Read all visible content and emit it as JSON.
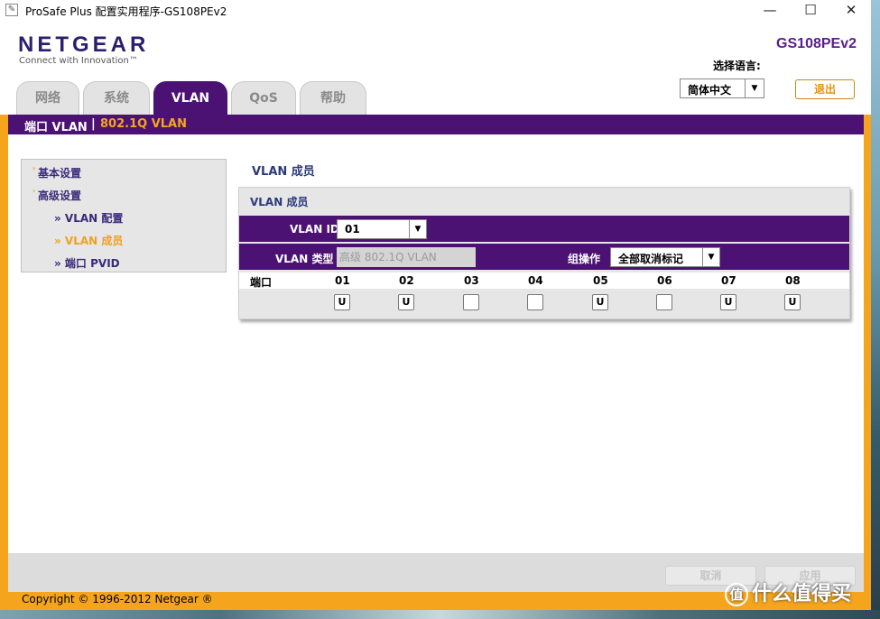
{
  "window": {
    "title": "ProSafe Plus 配置实用程序-GS108PEv2",
    "minimize": "—",
    "maximize": "☐",
    "close": "✕"
  },
  "header": {
    "logo": "NETGEAR",
    "logo_sub": "Connect with Innovation™",
    "model": "GS108PEv2",
    "lang_label": "选择语言:",
    "lang_value": "简体中文",
    "logout": "退出"
  },
  "tabs": [
    {
      "label": "网络"
    },
    {
      "label": "系统"
    },
    {
      "label": "VLAN"
    },
    {
      "label": "QoS"
    },
    {
      "label": "帮助"
    }
  ],
  "subnav": {
    "item1": "端口 VLAN",
    "separator": "|",
    "item2": "802.1Q VLAN"
  },
  "sidebar": {
    "basic": "基本设置",
    "advanced": "高级设置",
    "vlan_config": "» VLAN 配置",
    "vlan_members": "» VLAN 成员",
    "port_pvid": "» 端口 PVID"
  },
  "main": {
    "page_title": "VLAN 成员",
    "panel_title": "VLAN 成员",
    "vlan_id_label": "VLAN ID",
    "vlan_id_value": "01",
    "vlan_type_label": "VLAN 类型",
    "vlan_type_value": "高级 802.1Q VLAN",
    "group_op_label": "组操作",
    "group_op_value": "全部取消标记",
    "ports_label": "端口",
    "ports": [
      {
        "id": "01",
        "state": "U"
      },
      {
        "id": "02",
        "state": "U"
      },
      {
        "id": "03",
        "state": ""
      },
      {
        "id": "04",
        "state": ""
      },
      {
        "id": "05",
        "state": "U"
      },
      {
        "id": "06",
        "state": ""
      },
      {
        "id": "07",
        "state": "U"
      },
      {
        "id": "08",
        "state": "U"
      }
    ]
  },
  "footer": {
    "cancel": "取消",
    "apply": "应用",
    "copyright": "Copyright © 1996-2012 Netgear ®"
  },
  "watermark": {
    "glyph": "值",
    "text": "什么值得买"
  },
  "colors": {
    "purple": "#4b1274",
    "orange": "#f5a51d",
    "accent_text": "#f0a020"
  }
}
